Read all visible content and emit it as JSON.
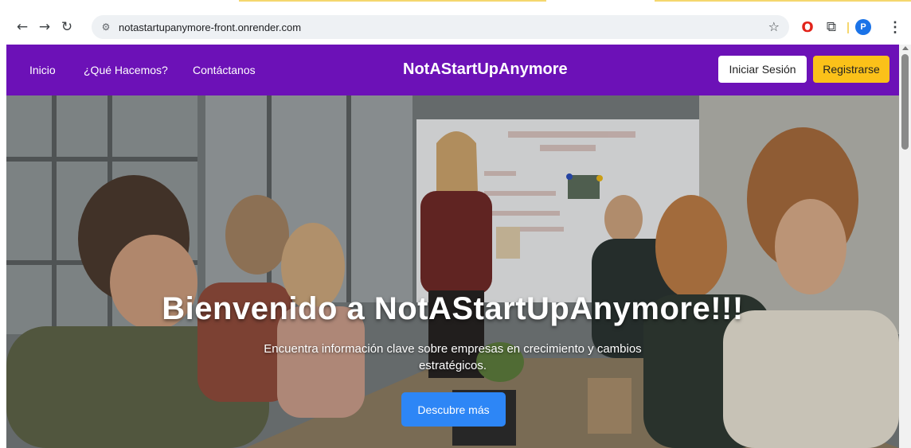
{
  "browser": {
    "url": "notastartupanymore-front.onrender.com",
    "profile_initial": "P",
    "icons": {
      "back": "back-arrow-icon",
      "forward": "forward-arrow-icon",
      "reload": "reload-icon",
      "site_info": "site-settings-icon",
      "bookmark": "star-icon",
      "opera": "opera-icon",
      "extensions": "puzzle-icon",
      "menu": "kebab-menu-icon"
    }
  },
  "nav": {
    "links": [
      "Inicio",
      "¿Qué Hacemos?",
      "Contáctanos"
    ],
    "brand": "NotAStartUpAnymore",
    "login_label": "Iniciar Sesión",
    "register_label": "Registrarse",
    "colors": {
      "bar": "#6c11b7",
      "register": "#fbc119",
      "login": "#ffffff"
    }
  },
  "hero": {
    "title": "Bienvenido a NotAStartUpAnymore!!!",
    "subtitle": "Encuentra información clave sobre empresas en crecimiento y cambios estratégicos.",
    "cta_label": "Descubre más",
    "cta_color": "#2d86f6"
  }
}
